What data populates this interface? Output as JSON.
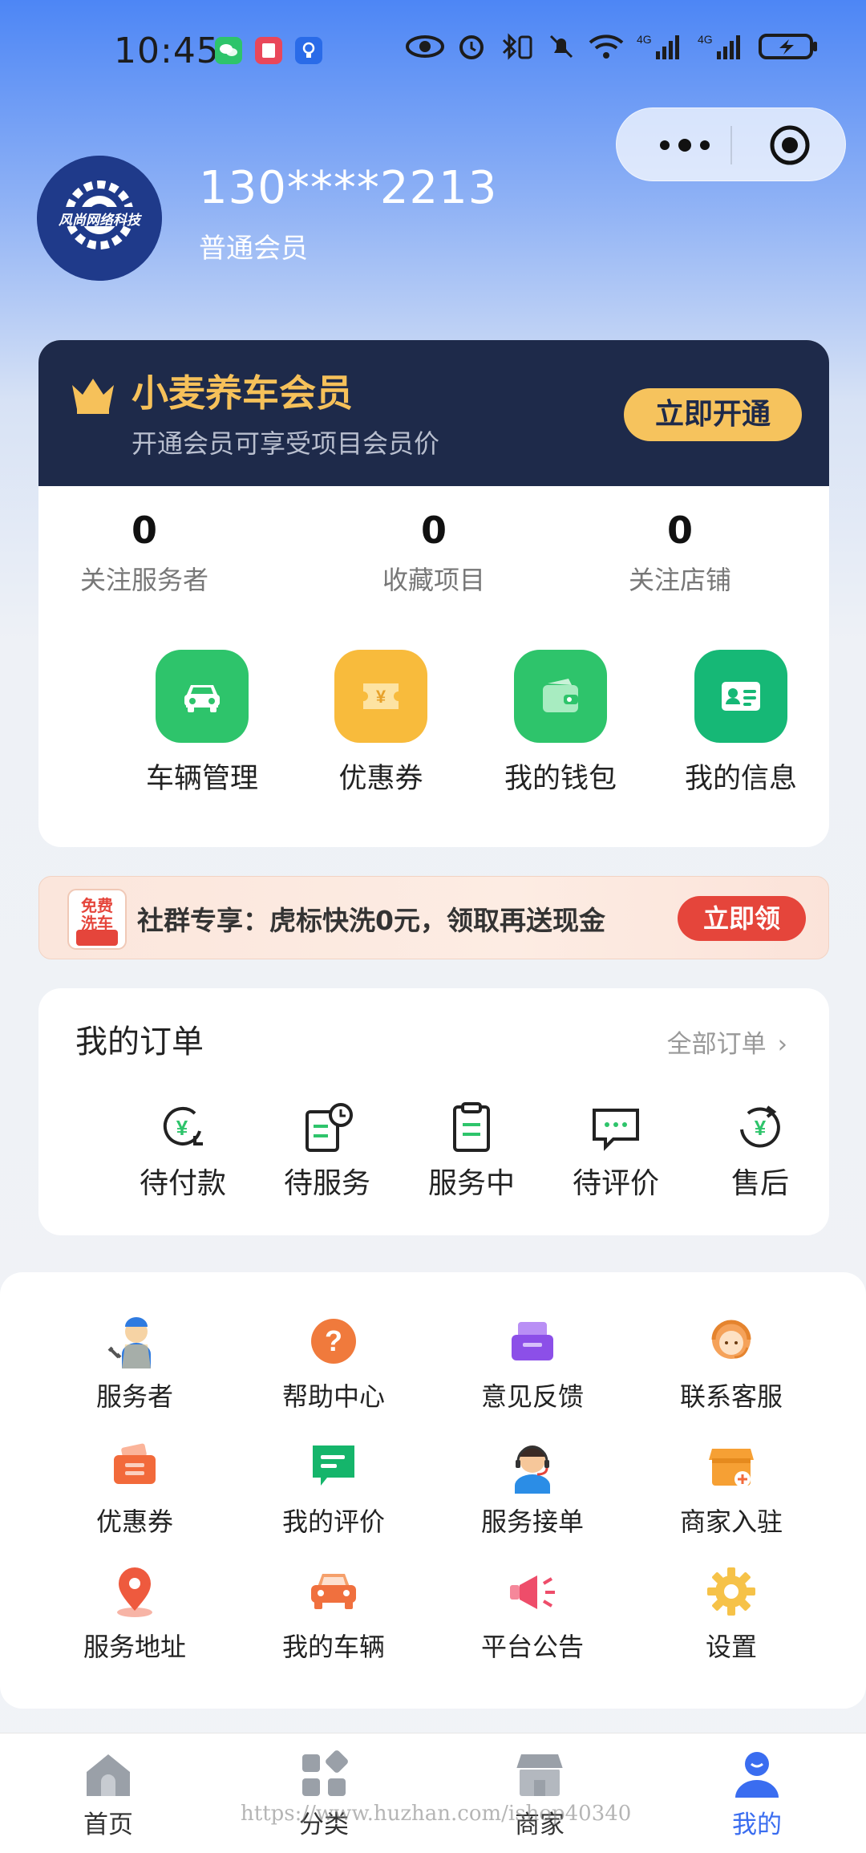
{
  "status_bar": {
    "time": "10:45",
    "network_1": "4G",
    "network_2": "4G"
  },
  "profile": {
    "phone": "130****2213",
    "level": "普通会员",
    "avatar_text": "风尚网络科技"
  },
  "vip": {
    "title": "小麦养车会员",
    "subtitle": "开通会员可享受项目会员价",
    "button": "立即开通"
  },
  "stats": [
    {
      "value": "0",
      "label": "关注服务者"
    },
    {
      "value": "0",
      "label": "收藏项目"
    },
    {
      "value": "0",
      "label": "关注店铺"
    }
  ],
  "tools": [
    {
      "label": "车辆管理",
      "icon": "car-icon",
      "color": "#2ec46b"
    },
    {
      "label": "优惠券",
      "icon": "coupon-icon",
      "color": "#f8bb3c"
    },
    {
      "label": "我的钱包",
      "icon": "wallet-icon",
      "color": "#2ec46b"
    },
    {
      "label": "我的信息",
      "icon": "id-card-icon",
      "color": "#16b876"
    }
  ],
  "promo": {
    "badge_line1": "免费",
    "badge_line2": "洗车",
    "text": "社群专享：虎标快洗0元，领取再送现金",
    "button": "立即领"
  },
  "orders": {
    "title": "我的订单",
    "all_link": "全部订单",
    "items": [
      {
        "label": "待付款",
        "icon": "yen-pending-icon"
      },
      {
        "label": "待服务",
        "icon": "service-clock-icon"
      },
      {
        "label": "服务中",
        "icon": "clipboard-icon"
      },
      {
        "label": "待评价",
        "icon": "comment-icon"
      },
      {
        "label": "售后",
        "icon": "yen-refresh-icon"
      }
    ]
  },
  "services": [
    {
      "label": "服务者",
      "icon": "mechanic-icon"
    },
    {
      "label": "帮助中心",
      "icon": "help-icon"
    },
    {
      "label": "意见反馈",
      "icon": "feedback-icon"
    },
    {
      "label": "联系客服",
      "icon": "customer-service-icon"
    },
    {
      "label": "优惠券",
      "icon": "coupon-icon"
    },
    {
      "label": "我的评价",
      "icon": "review-icon"
    },
    {
      "label": "服务接单",
      "icon": "headset-agent-icon"
    },
    {
      "label": "商家入驻",
      "icon": "merchant-join-icon"
    },
    {
      "label": "服务地址",
      "icon": "location-icon"
    },
    {
      "label": "我的车辆",
      "icon": "car-icon"
    },
    {
      "label": "平台公告",
      "icon": "megaphone-icon"
    },
    {
      "label": "设置",
      "icon": "gear-icon"
    }
  ],
  "tabbar": [
    {
      "label": "首页",
      "icon": "home-icon",
      "active": false
    },
    {
      "label": "分类",
      "icon": "category-icon",
      "active": false
    },
    {
      "label": "商家",
      "icon": "store-icon",
      "active": false
    },
    {
      "label": "我的",
      "icon": "user-icon",
      "active": true
    }
  ],
  "watermark": "https://www.huzhan.com/ishop40340",
  "colors": {
    "accent": "#3a6df0",
    "vip_gold": "#f6c15a",
    "vip_dark": "#1e2a4a",
    "promo_red": "#e5453b"
  }
}
